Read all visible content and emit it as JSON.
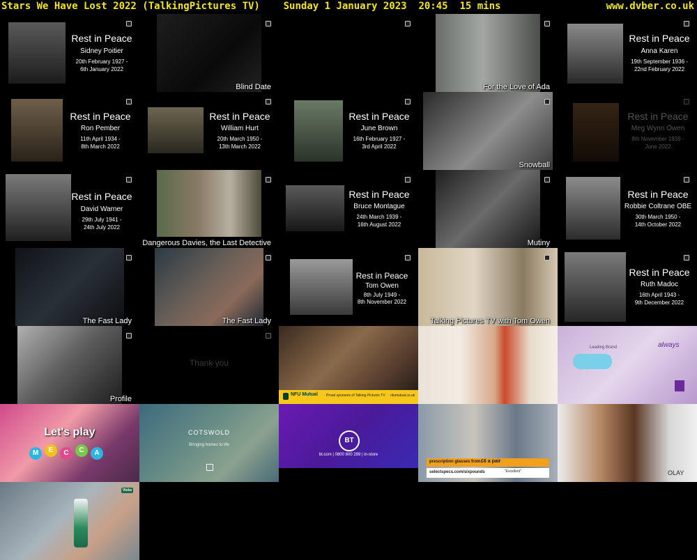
{
  "header": {
    "programme": "Stars We Have Lost 2022 (TalkingPictures TV)",
    "datetime": "Sunday 1 January 2023  20:45  15 mins",
    "site": "www.dvber.co.uk"
  },
  "colors": {
    "header_text": "#f2e51c",
    "background": "#000000"
  },
  "frames": {
    "f01": {
      "title": "Rest in Peace",
      "name": "Sidney Poitier",
      "born": "20th February 1927 -",
      "died": "6th January 2022"
    },
    "f02": {
      "caption": "Blind Date"
    },
    "f04": {
      "caption": "For the Love of Ada"
    },
    "f05": {
      "title": "Rest in Peace",
      "name": "Anna Karen",
      "born": "19th September 1936 -",
      "died": "22nd February 2022"
    },
    "f06": {
      "title": "Rest in Peace",
      "name": "Ron Pember",
      "born": "11th April 1934 -",
      "died": "8th March 2022"
    },
    "f07": {
      "title": "Rest in Peace",
      "name": "William Hurt",
      "born": "20th March 1950 -",
      "died": "13th March  2022"
    },
    "f08": {
      "title": "Rest in Peace",
      "name": "June Brown",
      "born": "16th February 1927 -",
      "died": "3rd April 2022"
    },
    "f09": {
      "caption": "Snowball"
    },
    "f10": {
      "title": "Rest in Peace",
      "name": "Meg Wynn Owen",
      "born": "8th November 1939 -",
      "died": "June 2022"
    },
    "f11": {
      "title": "Rest in Peace",
      "name": "David Warner",
      "born": "29th July 1941 -",
      "died": "24th July 2022"
    },
    "f12": {
      "caption": "Dangerous Davies, the Last Detective"
    },
    "f13": {
      "title": "Rest in Peace",
      "name": "Bruce Montague",
      "born": "24th March 1939 -",
      "died": "16th August 2022"
    },
    "f14": {
      "caption": "Mutiny"
    },
    "f15": {
      "title": "Rest in Peace",
      "name": "Robbie Coltrane OBE",
      "born": "30th March 1950 -",
      "died": "14th October 2022"
    },
    "f16": {
      "caption": "The Fast Lady"
    },
    "f17": {
      "caption": "The Fast Lady"
    },
    "f18": {
      "title": "Rest in Peace",
      "name": "Tom Owen",
      "born": "8th July 1949 -",
      "died": "8th November 2022"
    },
    "f19": {
      "caption": "Talking Pictures TV with Tom Owen"
    },
    "f20": {
      "title": "Rest in Peace",
      "name": "Ruth Madoc",
      "born": "16th April 1943 -",
      "died": "9th December 2022"
    },
    "f21": {
      "caption": "Profile"
    },
    "f22": {
      "text": "Thank you"
    },
    "f23": {
      "brand": "NFU Mutual",
      "strap": "Proud sponsors of Talking Pictures TV",
      "url": "nfumutual.co.uk"
    },
    "f25": {
      "text": "Leading Brand",
      "brand": "always"
    },
    "f26": {
      "headline": "Let's play",
      "letters": [
        "M",
        "E",
        "C",
        "C",
        "A"
      ]
    },
    "f27": {
      "brand": "COTSWOLD",
      "tagline": "Bringing homes to life"
    },
    "f28": {
      "logo": "BT",
      "contact": "bt.com | 0800 800 289 | in-store"
    },
    "f29": {
      "offer": "prescription glasses from",
      "price": "£6 a pair",
      "brand": "selectspecs.com/sixpounds",
      "rating": "\"Excellent\""
    },
    "f30": {
      "brand": "OLAY"
    },
    "f31": {
      "brand": "Vicks"
    }
  }
}
